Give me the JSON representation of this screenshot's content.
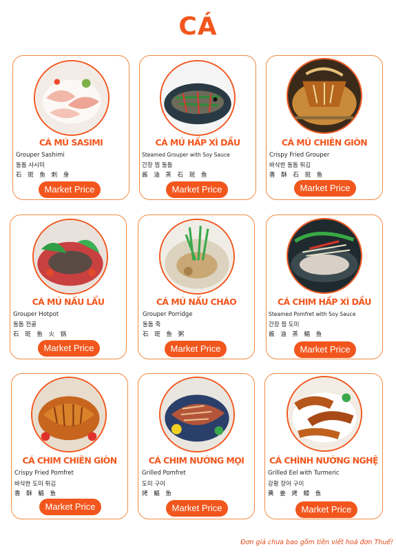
{
  "page": {
    "title": "CÁ"
  },
  "colors": {
    "accent": "#f2561d",
    "border": "#f2893f"
  },
  "dishes": [
    {
      "title": "CÁ MÚ SASIMI",
      "en": "Grouper Sashimi",
      "kr": "돌돔 사시미",
      "cn": "石 斑 鱼 刺 身",
      "price": "Market Price",
      "icon": "sashimi-photo"
    },
    {
      "title": "CÁ MÚ HẤP XÌ DẦU",
      "en": "Steamed Grouper with Soy Sauce",
      "kr": "간장 찜 돌돔",
      "cn": "酱 油 蒸 石 斑 鱼",
      "price": "Market Price",
      "icon": "steamed-grouper-photo"
    },
    {
      "title": "CÁ MÚ CHIÊN GIÒN",
      "en": "Crispy Fried Grouper",
      "kr": "바삭한 돌돔 튀김",
      "cn": "香 酥 石 斑 鱼",
      "price": "Market Price",
      "icon": "fried-grouper-photo"
    },
    {
      "title": "CÁ MÚ NẤU LẨU",
      "en": "Grouper Hotpot",
      "kr": "돌돔 전골",
      "cn": "石 斑 鱼 火 锅",
      "price": "Market Price",
      "icon": "hotpot-photo"
    },
    {
      "title": "CÁ MÚ NẤU CHÁO",
      "en": "Grouper Porridge",
      "kr": "돌돔 죽",
      "cn": "石 斑 鱼 粥",
      "price": "Market Price",
      "icon": "porridge-photo"
    },
    {
      "title": "CÁ CHIM HẤP XÌ DẦU",
      "en": "Steamed Pomfret with Soy Sauce",
      "kr": "간장 찜 도미",
      "cn": "酱 油 蒸 鲳 鱼",
      "price": "Market Price",
      "icon": "steamed-pomfret-photo"
    },
    {
      "title": "CÁ CHIM CHIÊN GIÒN",
      "en": "Crispy Fried Pomfret",
      "kr": "바삭한 도미 튀김",
      "cn": "香 酥 鲳 鱼",
      "price": "Market Price",
      "icon": "fried-pomfret-photo"
    },
    {
      "title": "CÁ CHIM NƯỚNG MỌI",
      "en": "Grilled Pomfret",
      "kr": "도미 구이",
      "cn": "烤 鲳 鱼",
      "price": "Market Price",
      "icon": "grilled-pomfret-photo"
    },
    {
      "title": "CÁ CHÌNH NƯỚNG NGHỆ",
      "en": "Grilled Eel with Turmeric",
      "kr": "강황 장어 구이",
      "cn": "黄 姜 烤 鳗 鱼",
      "price": "Market Price",
      "icon": "grilled-eel-photo"
    }
  ],
  "footer": {
    "note": "Đơn giá chưa bao gồm tiền viết hoá đơn Thuế!"
  }
}
